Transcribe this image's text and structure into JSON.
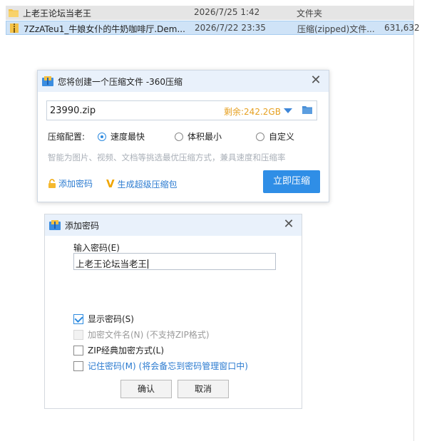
{
  "explorer": {
    "rows": [
      {
        "name": "上老王论坛当老王",
        "date": "2026/7/25 1:42",
        "type": "文件夹",
        "size": ""
      },
      {
        "name": "7ZzATeu1_牛娘女仆的牛奶咖啡厅.Dem...",
        "date": "2026/7/22 23:35",
        "type": "压缩(zipped)文件...",
        "size": "631,632"
      }
    ]
  },
  "compress_dialog": {
    "title": "您将创建一个压缩文件 -360压缩",
    "filename": "23990.zip",
    "remaining": "剩余:242.2GB",
    "option_label": "压缩配置:",
    "options": [
      "速度最快",
      "体积最小",
      "自定义"
    ],
    "selected_option": "速度最快",
    "hint": "智能为图片、视频、文档等挑选最优压缩方式，兼具速度和压缩率",
    "add_password": "添加密码",
    "super_package": "生成超级压缩包",
    "compress_button": "立即压缩"
  },
  "password_dialog": {
    "title": "添加密码",
    "input_label": "输入密码(E)",
    "password_value": "上老王论坛当老王",
    "checkboxes": [
      {
        "label": "显示密码(S)",
        "checked": true,
        "disabled": false
      },
      {
        "label": "加密文件名(N) (不支持ZIP格式)",
        "checked": false,
        "disabled": true
      },
      {
        "label": "ZIP经典加密方式(L)",
        "checked": false,
        "disabled": false
      },
      {
        "label": "记住密码(M) (将会备忘到密码管理窗口中)",
        "checked": false,
        "disabled": false
      }
    ],
    "ok_button": "确认",
    "cancel_button": "取消"
  },
  "colors": {
    "accent_blue": "#2f8ee6",
    "remaining_orange": "#e6a020",
    "selected_row": "#cfe3f7"
  }
}
